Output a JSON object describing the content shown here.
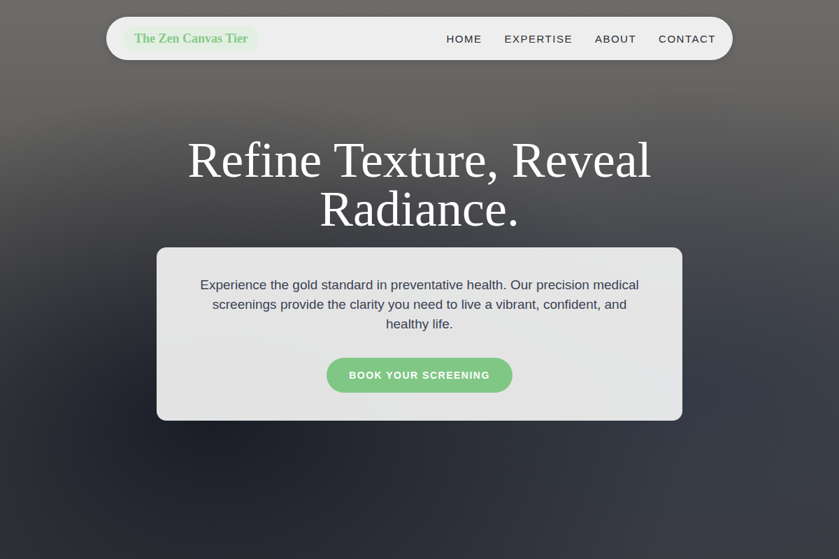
{
  "nav": {
    "logo": "The Zen Canvas Tier",
    "links": [
      {
        "label": "HOME"
      },
      {
        "label": "EXPERTISE"
      },
      {
        "label": "ABOUT"
      },
      {
        "label": "CONTACT"
      }
    ]
  },
  "hero": {
    "title": "Refine Texture, Reveal Radiance.",
    "description": "Experience the gold standard in preventative health. Our precision medical screenings provide the clarity you need to live a vibrant, confident, and healthy life.",
    "button": "BOOK YOUR SCREENING"
  }
}
